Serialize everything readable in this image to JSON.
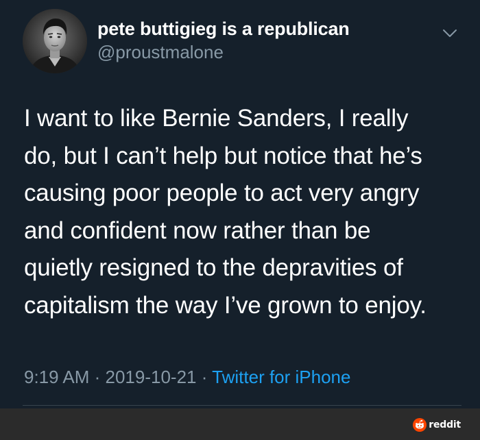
{
  "user": {
    "display_name": "pete buttigieg is a republican",
    "handle": "@proustmalone"
  },
  "tweet": {
    "lines": [
      "I want to like Bernie Sanders, I really",
      "do, but I can’t help but notice that he’s",
      "causing poor people to act very angry",
      "and confident now rather than be",
      "quietly resigned to the depravities of",
      "capitalism the way I’ve grown to enjoy."
    ]
  },
  "meta": {
    "time": "9:19 AM",
    "sep1": " · ",
    "date": "2019-10-21",
    "sep2": " · ",
    "source": "Twitter for iPhone"
  },
  "watermark": {
    "text": "reddit",
    "icon": "reddit-logo-icon",
    "color": "#ff4500"
  },
  "colors": {
    "background": "#15202b",
    "secondary_text": "#8899a6",
    "link": "#1da1f2",
    "footer_bar": "#2b2b2b"
  },
  "icons": {
    "more_menu": "chevron-down-icon",
    "avatar": "profile-photo"
  }
}
